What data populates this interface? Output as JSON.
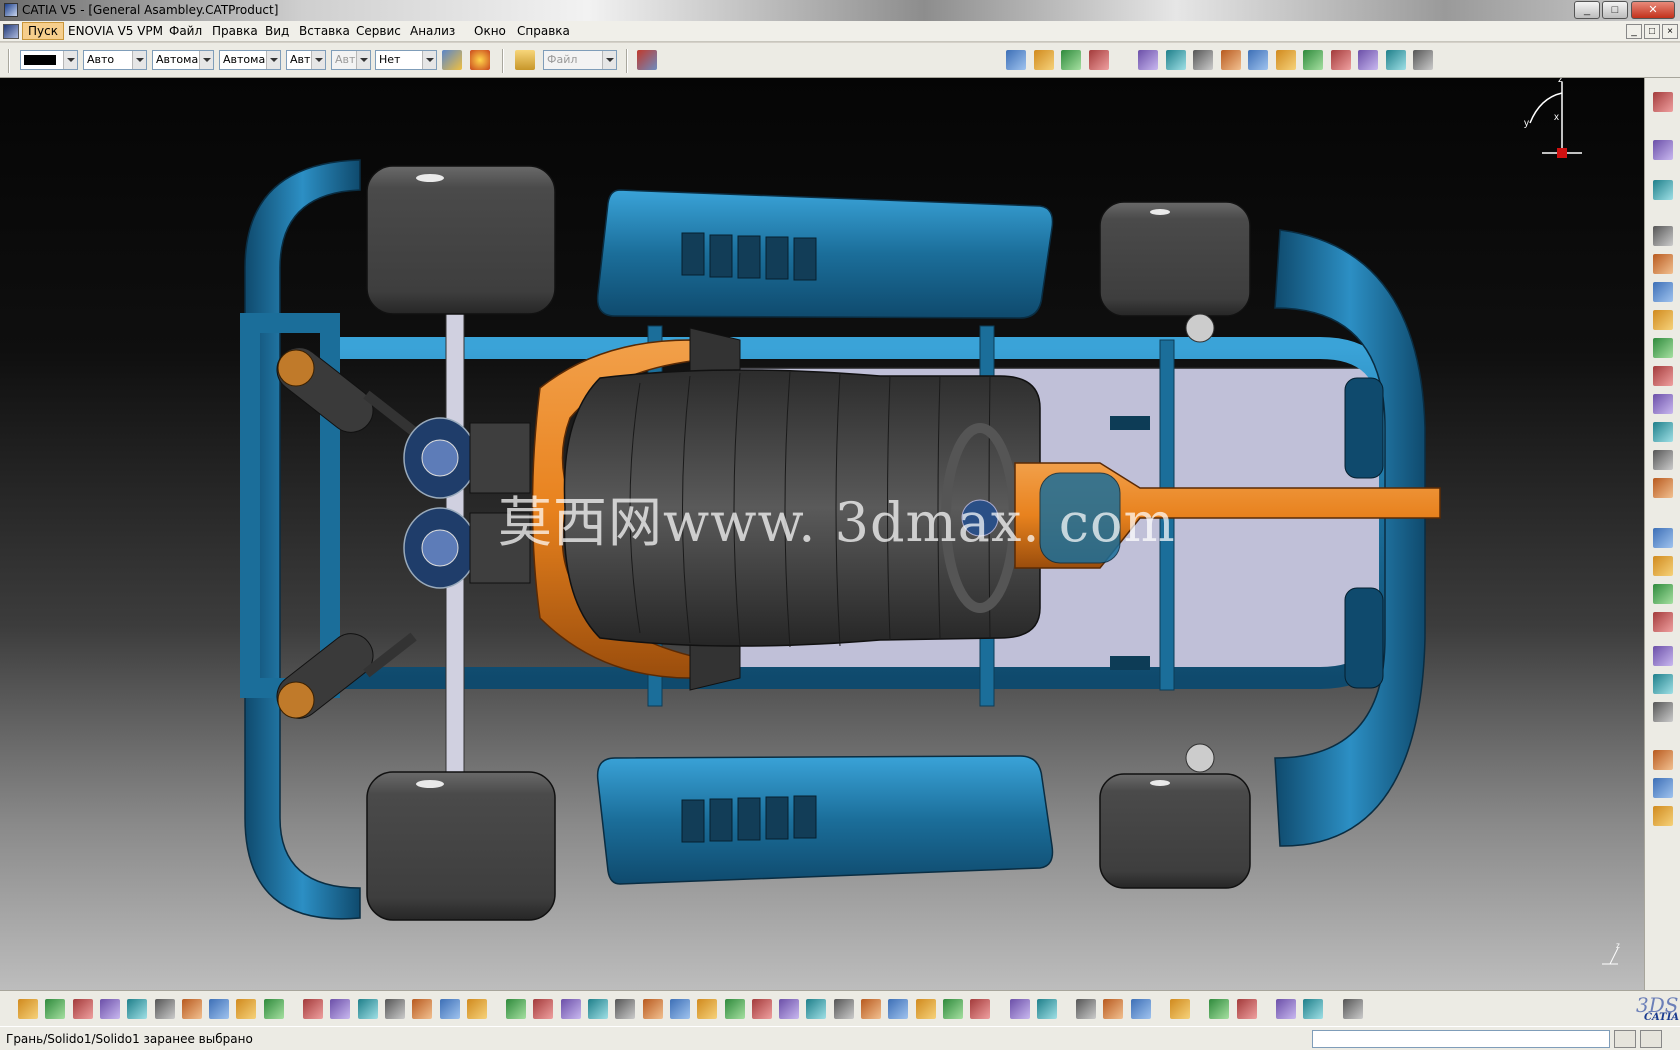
{
  "window": {
    "title": "CATIA V5 - [General Asambley.CATProduct]",
    "controls": {
      "minimize": "_",
      "maximize": "□",
      "close": "✕"
    }
  },
  "menu": {
    "items": [
      "Пуск",
      "ENOVIA V5 VPM",
      "Файл",
      "Правка",
      "Вид",
      "Вставка",
      "Сервис",
      "Анализ",
      "Окно",
      "Справка"
    ],
    "active": "Пуск",
    "doc_controls": [
      "_",
      "□",
      "×"
    ]
  },
  "toolbar_top": {
    "color_combo": {
      "value": "",
      "swatch_color": "#000000"
    },
    "combos": [
      {
        "name": "line-type-combo",
        "value": "Авто"
      },
      {
        "name": "line-weight-combo",
        "value": "Автома"
      },
      {
        "name": "layer-combo",
        "value": "Автома"
      },
      {
        "name": "transparency-combo",
        "value": "Авт"
      },
      {
        "name": "point-combo",
        "value": "Авт",
        "disabled": true
      },
      {
        "name": "layer-filter-combo",
        "value": "Нет"
      }
    ],
    "file_combo": {
      "value": "Файл",
      "disabled": true
    }
  },
  "icons": {
    "top_left": [
      "painter-icon",
      "brush-icon",
      "open-folder-icon",
      "disabled-file-icon",
      "catalog-icon"
    ],
    "top_right": [
      "new-component-icon",
      "new-product-icon",
      "new-part-icon",
      "existing-component-icon",
      "replace-component-icon",
      "graph-tree-icon",
      "multi-instantiation-icon",
      "manipulation-icon",
      "snap-icon",
      "explode-icon",
      "clash-icon",
      "sectioning-icon",
      "distance-icon",
      "flexible-icon",
      "reorder-icon"
    ],
    "right": [
      "compass-icon",
      "select-icon",
      "move-icon",
      "update-icon",
      "constraint-icon",
      "coincidence-icon",
      "contact-icon",
      "offset-icon",
      "angle-icon",
      "fix-icon",
      "fix-together-icon",
      "quick-constraint-icon",
      "flexible-rigid-icon",
      "change-constraint-icon",
      "reuse-pattern-icon",
      "bill-of-material-icon",
      "measure-item-icon",
      "measure-inertia-icon",
      "annotation-icon",
      "scene-icon",
      "catalog-browser-icon",
      "publication-icon",
      "save-management-icon",
      "generate-numbering-icon"
    ],
    "bottom": [
      "new-icon",
      "open-icon",
      "save-icon",
      "print-icon",
      "cut-icon",
      "copy-icon",
      "paste-icon",
      "undo-icon",
      "redo-icon",
      "whats-this-icon",
      "formula-icon",
      "knowledge-icon",
      "pin-icon",
      "table-icon",
      "tree-icon",
      "lock-icon",
      "structure-icon",
      "fly-mode-icon",
      "fit-all-icon",
      "pan-icon",
      "rotate-icon",
      "zoom-in-icon",
      "zoom-out-icon",
      "normal-view-icon",
      "multi-view-icon",
      "iso-view-icon",
      "shading-icon",
      "render-icon",
      "hide-show-icon",
      "swap-space-icon",
      "gear-icon",
      "gear-arrow-icon",
      "apply-material-icon",
      "open-box-icon",
      "robot-icon",
      "camera-icon",
      "print-screen-icon",
      "measure-between-icon",
      "measure-item-bottom-icon",
      "inertia-bottom-icon",
      "refresh-icon",
      "eraser-icon",
      "web-icon",
      "photo-icon",
      "catalog-bottom-icon",
      "grid-icon"
    ]
  },
  "viewport": {
    "background_top": "#050505",
    "background_bottom": "#bdbdbd",
    "watermark": "莫西网www. 3dmax. com",
    "compass_labels": {
      "z": "z",
      "x": "x",
      "y": "y"
    }
  },
  "colors": {
    "frame_blue": "#1b6e9a",
    "frame_blue_light": "#3aa3d8",
    "accent_orange": "#e8821e",
    "tire_gray": "#4a4a4a",
    "floor_panel": "#c0c0d8"
  },
  "status": {
    "text": "Грань/Solido1/Solido1 заранее выбрано",
    "command_input": ""
  },
  "logo": {
    "mark": "3DS",
    "text": "CATIA"
  }
}
